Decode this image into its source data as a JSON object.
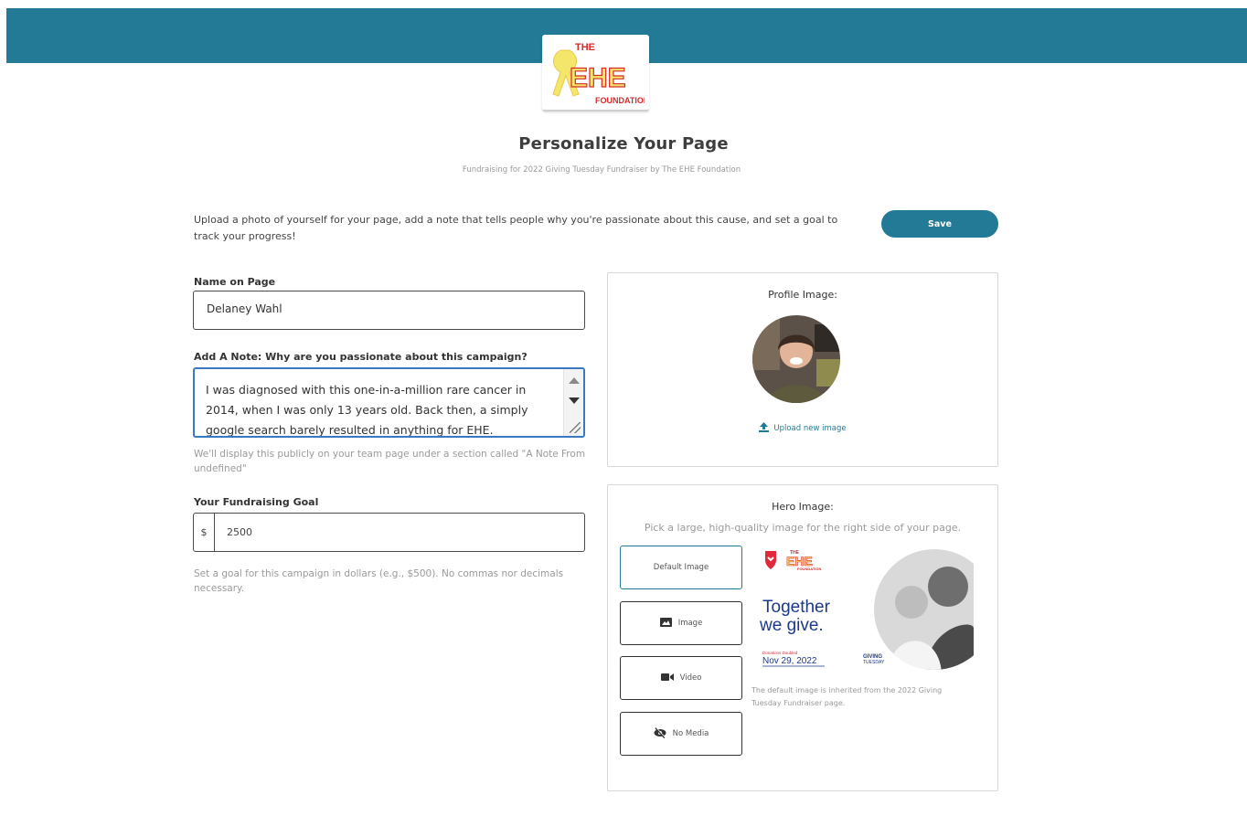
{
  "logo": {
    "line1": "THE",
    "line2": "EHE",
    "line3": "FOUNDATION"
  },
  "page": {
    "title": "Personalize Your Page",
    "subtitle": "Fundraising for 2022 Giving Tuesday Fundraiser by The EHE Foundation",
    "intro": "Upload a photo of yourself for your page, add a note that tells people why you're passionate about this cause, and set a goal to track your progress!",
    "save_label": "Save"
  },
  "form": {
    "name_label": "Name on Page",
    "name_value": "Delaney Wahl",
    "note_label": "Add A Note: Why are you passionate about this campaign?",
    "note_value": "I was diagnosed with this one-in-a-million rare cancer in 2014, when I was only 13 years old.  Back then, a simply google search barely resulted in anything for EHE.",
    "note_help": "We'll display this publicly on your team page under a section called \"A Note From undefined\"",
    "goal_label": "Your Fundraising Goal",
    "goal_prefix": "$",
    "goal_value": "2500",
    "goal_help": "Set a goal for this campaign in dollars (e.g., $500). No commas nor decimals necessary."
  },
  "profile": {
    "title": "Profile Image:",
    "upload_label": "Upload new image"
  },
  "hero": {
    "title": "Hero Image:",
    "subtitle": "Pick a large, high-quality image for the right side of your page.",
    "options": [
      {
        "label": "Default Image",
        "icon": "none",
        "selected": true
      },
      {
        "label": "Image",
        "icon": "image-icon"
      },
      {
        "label": "Video",
        "icon": "video-camera-icon"
      },
      {
        "label": "No Media",
        "icon": "eye-slash-icon"
      }
    ],
    "preview": {
      "headline1": "Together",
      "headline2": "we give.",
      "small_label": "Donations Doubled",
      "date": "Nov 29, 2022",
      "giving1": "GIVING",
      "giving2": "TUESDAY",
      "logo1": "THE",
      "logo2": "EHE",
      "logo3": "FOUNDATION"
    },
    "note": "The default image is inherited from the 2022 Giving Tuesday Fundraiser page."
  },
  "colors": {
    "brand": "#237a96",
    "focus": "#3a78c2",
    "ribbon": "#f3e66a",
    "logo_red": "#d62b2b"
  }
}
